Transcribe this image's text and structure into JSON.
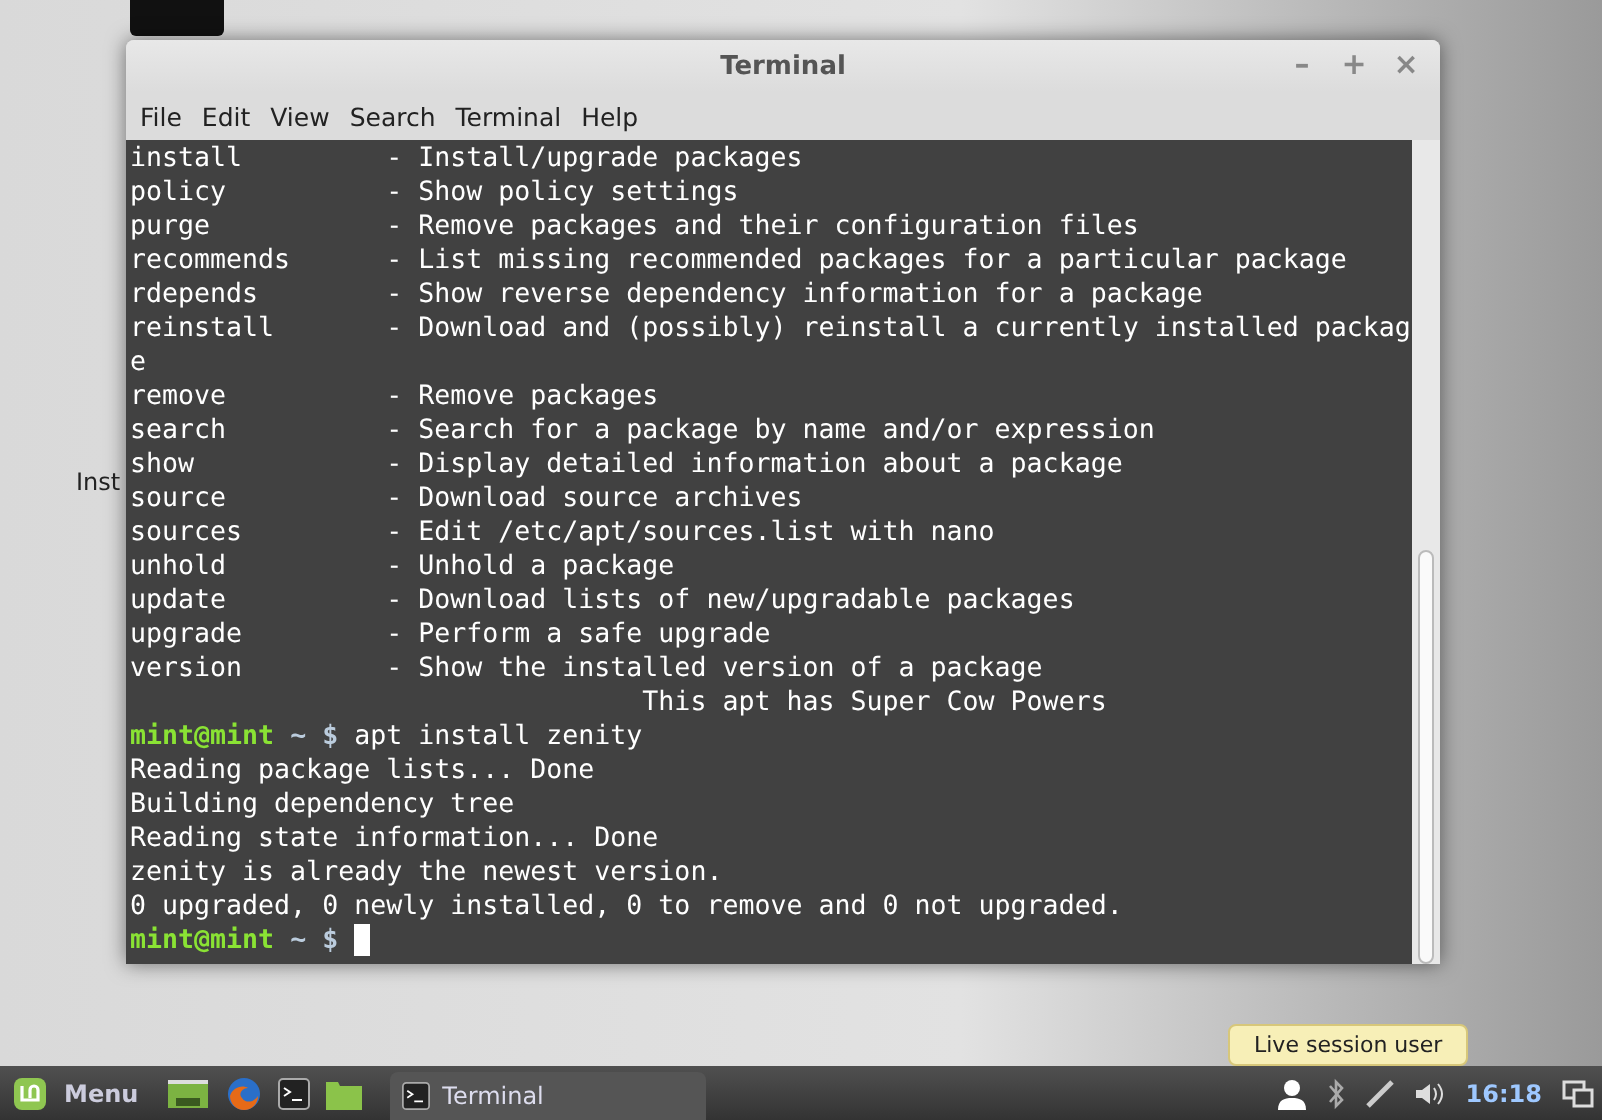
{
  "desktop": {
    "icon_label": "Inst"
  },
  "window": {
    "title": "Terminal",
    "controls": [
      "–",
      "+",
      "×"
    ],
    "menu": [
      {
        "label": "File"
      },
      {
        "label": "Edit"
      },
      {
        "label": "View"
      },
      {
        "label": "Search"
      },
      {
        "label": "Terminal"
      },
      {
        "label": "Help"
      }
    ],
    "lines": [
      {
        "kind": "plain",
        "text": "install         - Install/upgrade packages"
      },
      {
        "kind": "plain",
        "text": "policy          - Show policy settings"
      },
      {
        "kind": "plain",
        "text": "purge           - Remove packages and their configuration files"
      },
      {
        "kind": "plain",
        "text": "recommends      - List missing recommended packages for a particular package"
      },
      {
        "kind": "plain",
        "text": "rdepends        - Show reverse dependency information for a package"
      },
      {
        "kind": "plain",
        "text": "reinstall       - Download and (possibly) reinstall a currently installed packag"
      },
      {
        "kind": "plain",
        "text": "e"
      },
      {
        "kind": "plain",
        "text": "remove          - Remove packages"
      },
      {
        "kind": "plain",
        "text": "search          - Search for a package by name and/or expression"
      },
      {
        "kind": "plain",
        "text": "show            - Display detailed information about a package"
      },
      {
        "kind": "plain",
        "text": "source          - Download source archives"
      },
      {
        "kind": "plain",
        "text": "sources         - Edit /etc/apt/sources.list with nano"
      },
      {
        "kind": "plain",
        "text": "unhold          - Unhold a package"
      },
      {
        "kind": "plain",
        "text": "update          - Download lists of new/upgradable packages"
      },
      {
        "kind": "plain",
        "text": "upgrade         - Perform a safe upgrade"
      },
      {
        "kind": "plain",
        "text": "version         - Show the installed version of a package"
      },
      {
        "kind": "plain",
        "text": "                                This apt has Super Cow Powers"
      },
      {
        "kind": "prompt",
        "user": "mint@mint",
        "path": "~ $",
        "command": "apt install zenity",
        "cursor": false
      },
      {
        "kind": "plain",
        "text": "Reading package lists... Done"
      },
      {
        "kind": "plain",
        "text": "Building dependency tree"
      },
      {
        "kind": "plain",
        "text": "Reading state information... Done"
      },
      {
        "kind": "plain",
        "text": "zenity is already the newest version."
      },
      {
        "kind": "plain",
        "text": "0 upgraded, 0 newly installed, 0 to remove and 0 not upgraded."
      },
      {
        "kind": "prompt",
        "user": "mint@mint",
        "path": "~ $",
        "cursor": true
      }
    ]
  },
  "taskbar": {
    "menu_label": "Menu",
    "tasks": [
      {
        "label": "Terminal",
        "selected": true
      }
    ],
    "clock": "16:18"
  },
  "tooltip": "Live session user"
}
